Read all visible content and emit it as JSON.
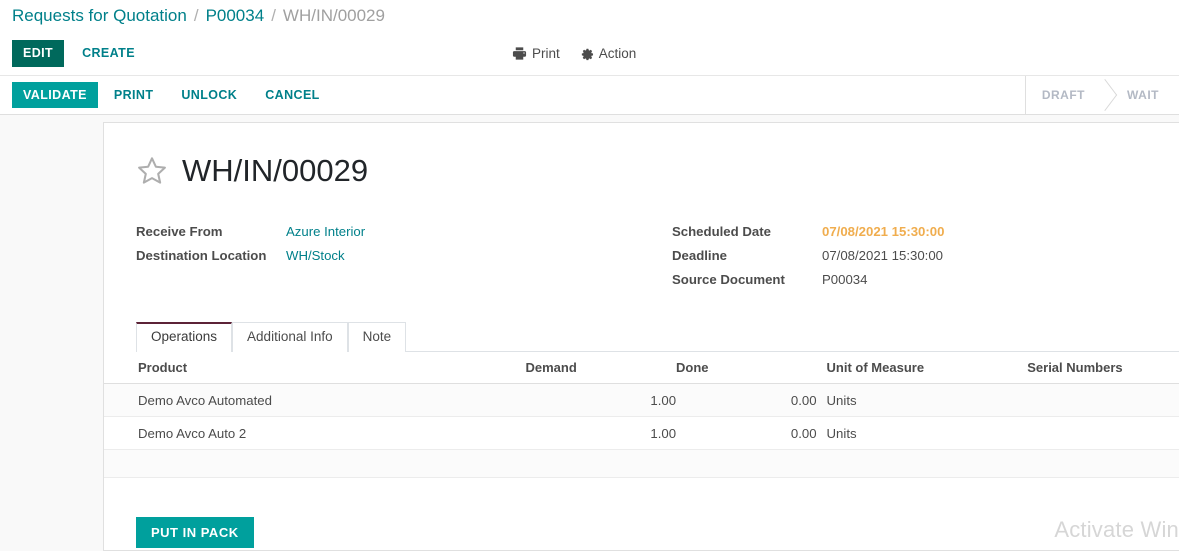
{
  "breadcrumb": {
    "items": [
      {
        "label": "Requests for Quotation",
        "type": "link"
      },
      {
        "label": "P00034",
        "type": "link"
      },
      {
        "label": "WH/IN/00029",
        "type": "current"
      }
    ],
    "separator": "/"
  },
  "control_panel": {
    "edit_label": "EDIT",
    "create_label": "CREATE",
    "print_label": "Print",
    "action_label": "Action"
  },
  "statusbar_actions": {
    "validate_label": "VALIDATE",
    "print_label": "PRINT",
    "unlock_label": "UNLOCK",
    "cancel_label": "CANCEL"
  },
  "statusbar": {
    "stages": [
      {
        "label": "DRAFT",
        "active": false
      },
      {
        "label": "WAIT",
        "active": false
      }
    ]
  },
  "record": {
    "title": "WH/IN/00029",
    "favorite_icon": "star-outline-icon",
    "left_fields": [
      {
        "label": "Receive From",
        "value": "Azure Interior",
        "style": "link"
      },
      {
        "label": "Destination Location",
        "value": "WH/Stock",
        "style": "link"
      }
    ],
    "right_fields": [
      {
        "label": "Scheduled Date",
        "value": "07/08/2021 15:30:00",
        "style": "warn"
      },
      {
        "label": "Deadline",
        "value": "07/08/2021 15:30:00",
        "style": "plain"
      },
      {
        "label": "Source Document",
        "value": "P00034",
        "style": "plain"
      }
    ]
  },
  "notebook": {
    "tabs": [
      {
        "label": "Operations",
        "active": true
      },
      {
        "label": "Additional Info",
        "active": false
      },
      {
        "label": "Note",
        "active": false
      }
    ]
  },
  "lines_table": {
    "columns": [
      "Product",
      "Demand",
      "Done",
      "Unit of Measure",
      "Serial Numbers",
      ""
    ],
    "rows": [
      {
        "product": "Demo Avco Automated",
        "demand": "1.00",
        "done": "0.00",
        "uom": "Units",
        "serial": "",
        "detail_icon": "list-detail-icon"
      },
      {
        "product": "Demo Avco Auto 2",
        "demand": "1.00",
        "done": "0.00",
        "uom": "Units",
        "serial": "",
        "detail_icon": "list-detail-icon"
      }
    ]
  },
  "footer": {
    "put_in_pack_label": "PUT IN PACK"
  },
  "watermark": {
    "text": "Activate Win"
  },
  "colors": {
    "brand_teal": "#00a09d",
    "dark_teal": "#00695c",
    "link_teal": "#00808a",
    "warning_orange": "#f0ad4e",
    "active_tab_border": "#5c2337",
    "muted_gray": "#b3b9c4"
  }
}
